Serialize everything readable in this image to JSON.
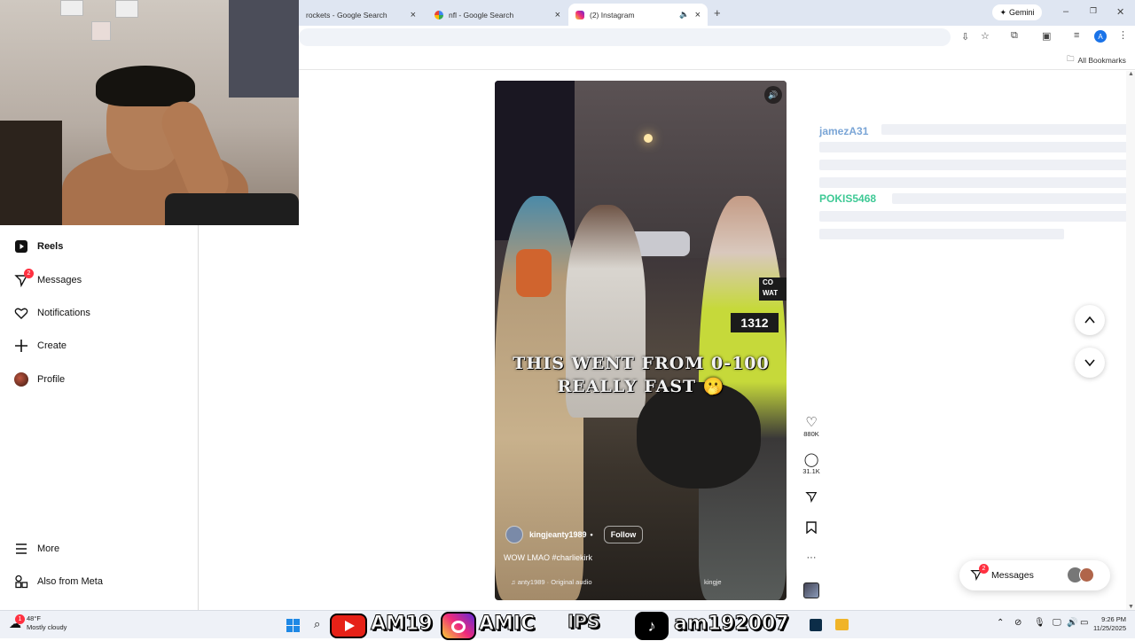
{
  "tabs": [
    {
      "title": "rockets - Google Search",
      "close": "×"
    },
    {
      "title": "nfl - Google Search",
      "close": "×"
    },
    {
      "title": "(2) Instagram",
      "close": "×"
    }
  ],
  "new_tab": "+",
  "gemini_label": "Gemini",
  "window_controls": {
    "minimize": "–",
    "restore": "❐",
    "close": "✕"
  },
  "profile_initial": "A",
  "bookmarks": {
    "all_bookmarks": "All Bookmarks"
  },
  "sidebar": {
    "items": [
      {
        "label": "Reels"
      },
      {
        "label": "Messages",
        "badge": "2"
      },
      {
        "label": "Notifications"
      },
      {
        "label": "Create"
      },
      {
        "label": "Profile"
      }
    ],
    "bottom": [
      {
        "label": "More"
      },
      {
        "label": "Also from Meta"
      }
    ]
  },
  "reel": {
    "caption": "THIS WENT FROM 0-100 REALLY FAST 🫢",
    "author": "kingjeanty1989",
    "follow": "Follow",
    "description": "WOW LMAO #charliekirk",
    "audio": "anty1989 · Original audio",
    "audio_tag": "kingje",
    "vest_text": "1312",
    "vest_word": "CO WAT"
  },
  "actions": {
    "likes": "880K",
    "comments": "31.1K",
    "more": "···"
  },
  "chat": [
    {
      "user": "jamezA31",
      "user_color": "#7aa5d6"
    },
    {
      "user": "POKIS5468",
      "user_color": "#3ec995"
    }
  ],
  "messages_pill": {
    "label": "Messages",
    "badge": "2"
  },
  "stream_overlay": {
    "name1": "AM19",
    "name2": "AMIC",
    "clips": "IPS",
    "name3": "am192007"
  },
  "taskbar": {
    "weather_temp": "48°F",
    "weather_desc": "Mostly cloudy",
    "weather_badge": "1",
    "time": "9:26 PM",
    "date": "11/25/2025"
  }
}
